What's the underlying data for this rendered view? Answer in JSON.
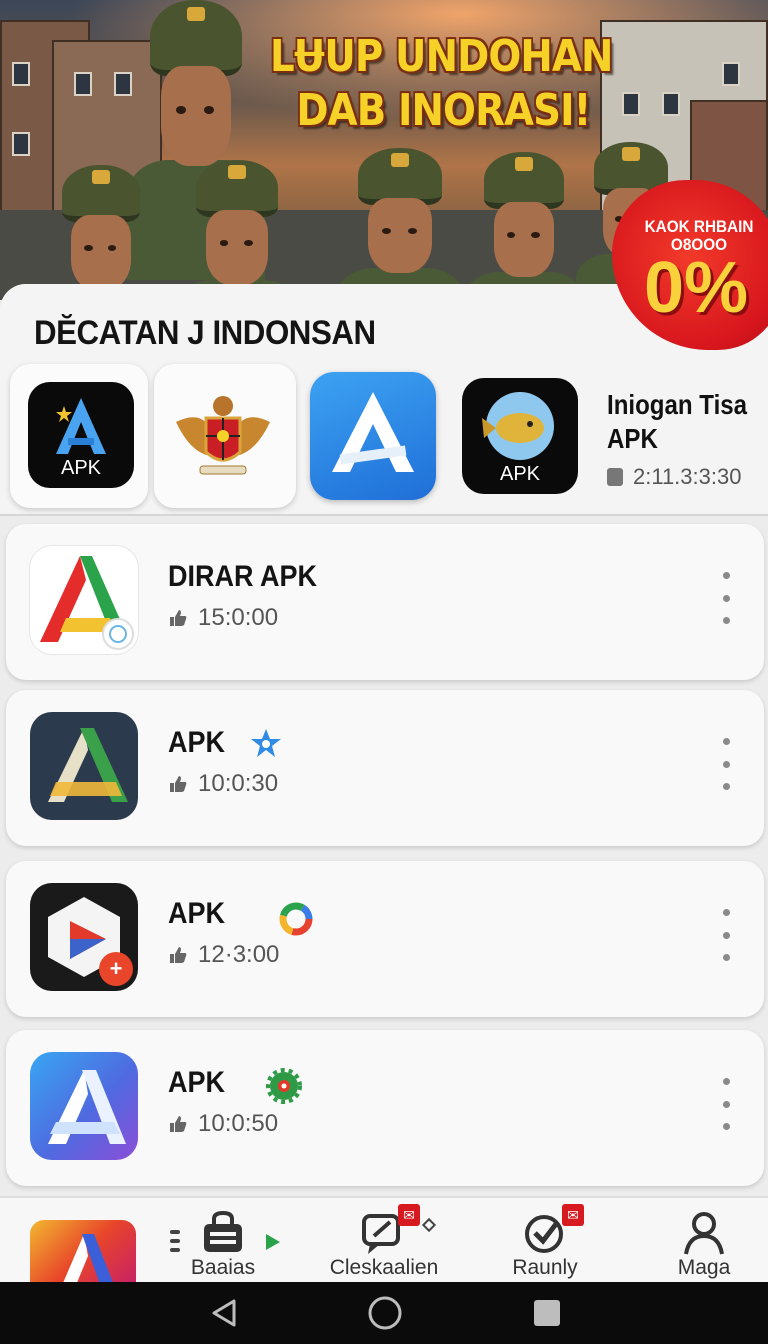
{
  "hero": {
    "headline_line1": "LɄUP UNDOHAN",
    "headline_line2": "DAB INORASI!",
    "promo_text": "KAOK RHBAIN O8OOO",
    "promo_percent": "0%"
  },
  "section": {
    "title": "DĔCATAN J INDONSAN"
  },
  "carousel": {
    "items": [
      {
        "label": "APK",
        "icon": "apk-store-icon-black"
      },
      {
        "label": "",
        "icon": "garuda-emblem-icon"
      },
      {
        "label": "",
        "icon": "app-store-icon-blue"
      },
      {
        "label": "APK",
        "icon": "fish-apk-icon"
      }
    ],
    "featured_name": "Iniogan Tisa",
    "featured_type": "APK",
    "featured_meta": "2:11.3:3:30"
  },
  "list": [
    {
      "title": "DIRAR APK",
      "time": "15:0:00",
      "icon": "red-green-a-icon",
      "badge": ""
    },
    {
      "title": "APK",
      "time": "10:0:30",
      "icon": "dark-a-icon",
      "badge": "blue-star-badge-icon"
    },
    {
      "title": "APK",
      "time": "12·3:00",
      "icon": "cube-play-icon",
      "badge": "google-ring-badge-icon"
    },
    {
      "title": "APK",
      "time": "10:0:50",
      "icon": "gradient-a-icon",
      "badge": "green-gear-badge-icon"
    }
  ],
  "bottom_nav": {
    "items": [
      {
        "label": "Baaias",
        "icon": "bag-icon"
      },
      {
        "label": "Cleskaalien",
        "icon": "chat-edit-icon"
      },
      {
        "label": "Raunly",
        "icon": "check-circle-icon"
      },
      {
        "label": "Maga",
        "icon": "person-icon"
      }
    ]
  },
  "colors": {
    "accent_red": "#d7161d",
    "title_yellow": "#f6d229",
    "sheet_bg": "#f4f4f4"
  }
}
